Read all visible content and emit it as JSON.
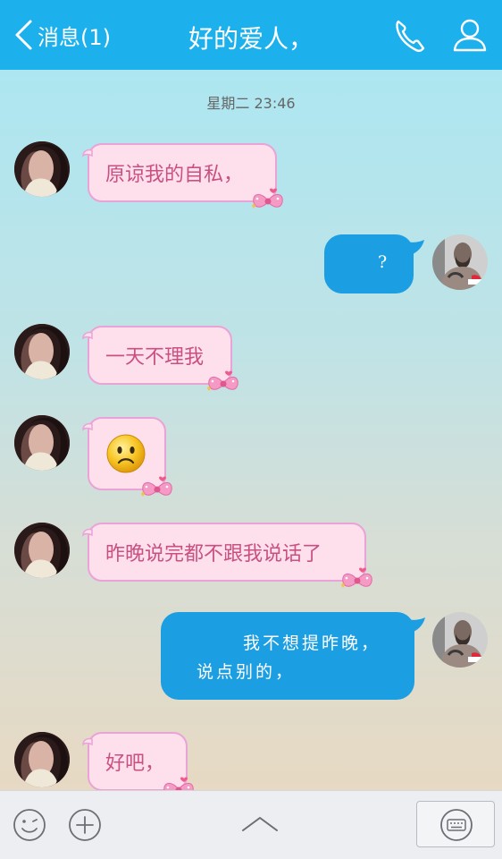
{
  "header": {
    "back_label": "消息(1)",
    "title": "好的爱人，",
    "bg_color": "#1cb1ec"
  },
  "chat": {
    "timestamp": "星期二 23:46",
    "messages": [
      {
        "side": "incoming",
        "text": "原谅我的自私，"
      },
      {
        "side": "outgoing",
        "text": "?"
      },
      {
        "side": "incoming",
        "text": "一天不理我"
      },
      {
        "side": "incoming",
        "emoji": "sad-face-emoji"
      },
      {
        "side": "incoming",
        "text": "昨晚说完都不跟我说话了"
      },
      {
        "side": "outgoing",
        "line1": "我不想提昨晚，",
        "line2": "说点别的，"
      },
      {
        "side": "incoming",
        "text": "好吧，"
      }
    ]
  },
  "colors": {
    "incoming_bubble": "#fde0ec",
    "incoming_border": "#e9a3d7",
    "incoming_text": "#c95081",
    "outgoing_bubble": "#1c9ee3"
  },
  "toolbar": {
    "icons": [
      "emoji-icon",
      "plus-icon",
      "chevron-up-icon",
      "keyboard-icon"
    ]
  }
}
